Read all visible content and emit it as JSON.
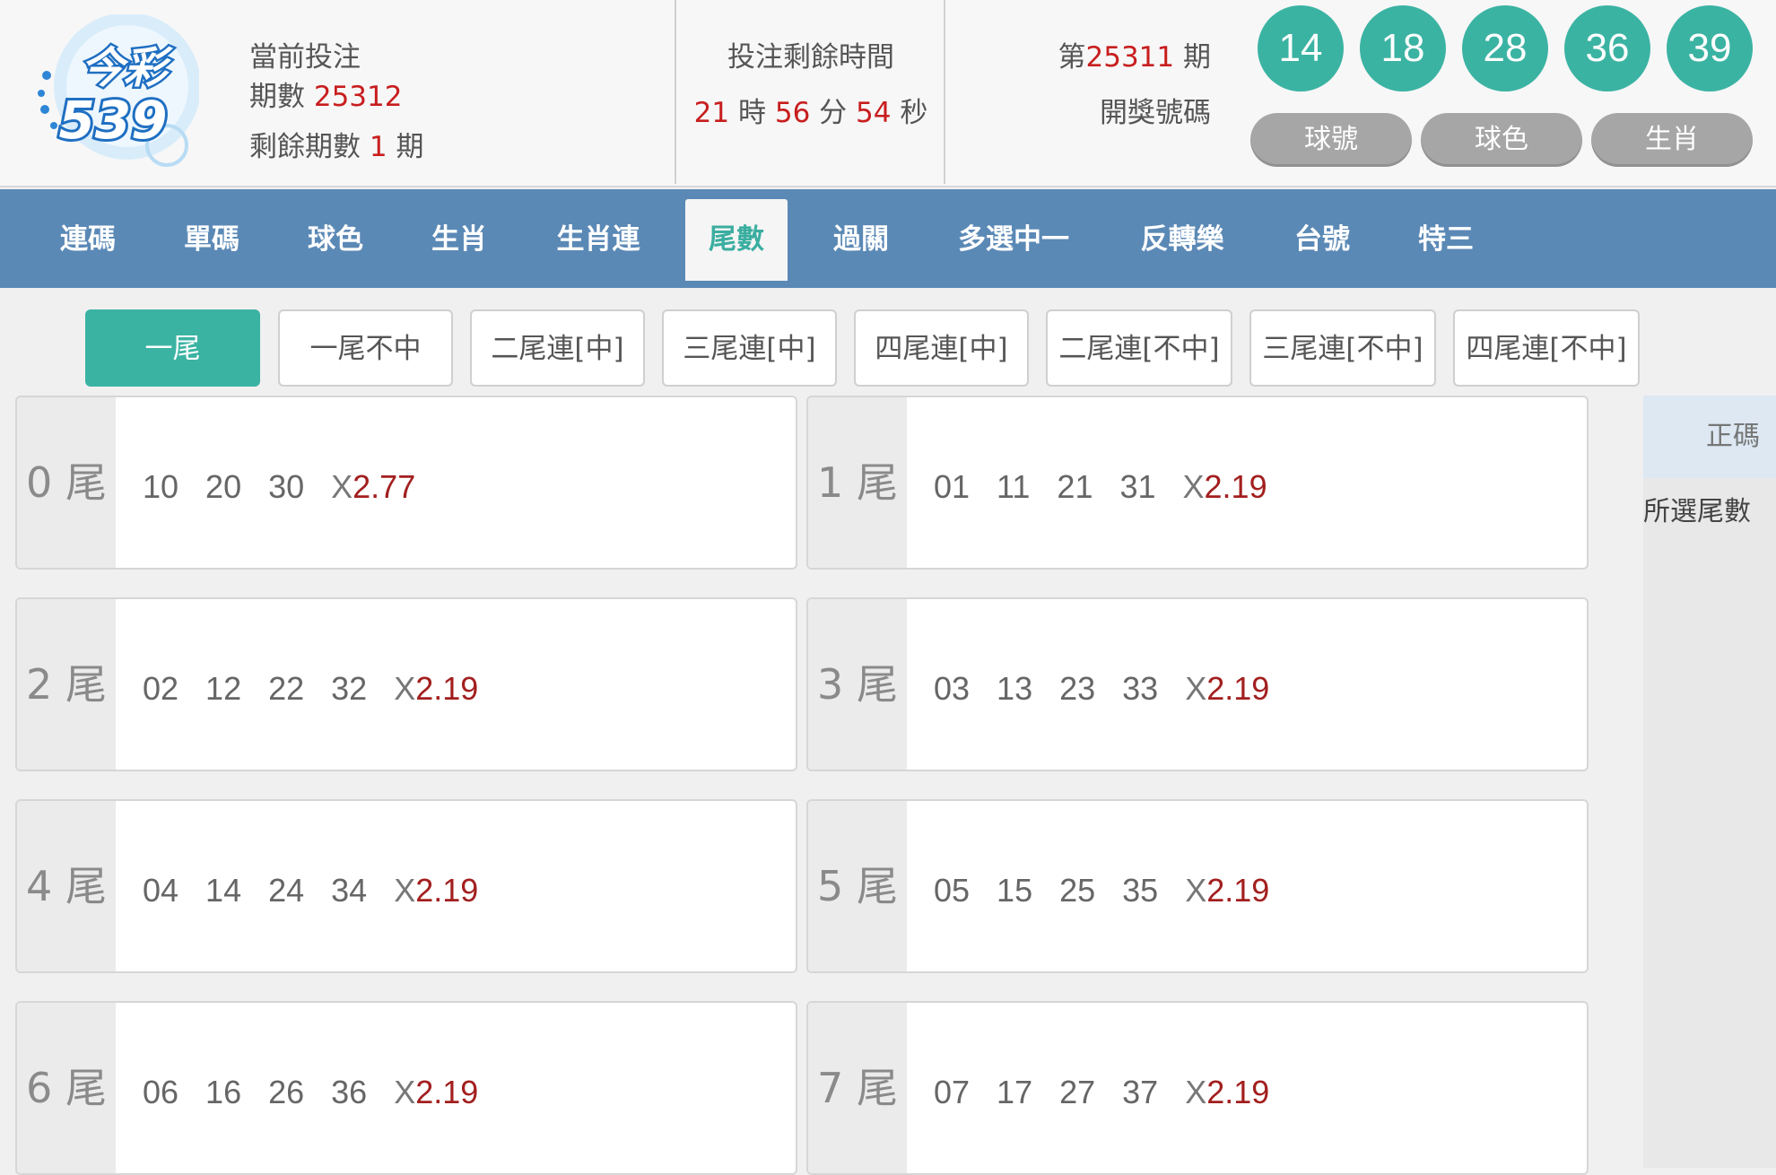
{
  "header": {
    "current_bet_label": "當前投注",
    "period_label": "期數",
    "period_value": "25312",
    "remaining_label": "剩餘期數",
    "remaining_value": "1",
    "remaining_unit": "期",
    "timer_title": "投注剩餘時間",
    "timer": {
      "hours": "21",
      "h_unit": "時",
      "minutes": "56",
      "m_unit": "分",
      "seconds": "54",
      "s_unit": "秒"
    },
    "last_draw_prefix": "第",
    "last_draw_period": "25311",
    "last_draw_suffix": "期",
    "last_draw_label": "開獎號碼",
    "balls": [
      "14",
      "18",
      "28",
      "36",
      "39"
    ],
    "pills": [
      "球號",
      "球色",
      "生肖"
    ],
    "colors": {
      "ball": "#3bb3a3",
      "pill": "#a6a6a6",
      "accent_red": "#c81e1e"
    }
  },
  "nav": {
    "items": [
      "連碼",
      "單碼",
      "球色",
      "生肖",
      "生肖連",
      "尾數",
      "過關",
      "多選中一",
      "反轉樂",
      "台號",
      "特三"
    ],
    "active": "尾數",
    "color": "#5b89b6"
  },
  "subtabs": {
    "items": [
      "一尾",
      "一尾不中",
      "二尾連[中]",
      "三尾連[中]",
      "四尾連[中]",
      "二尾連[不中]",
      "三尾連[不中]",
      "四尾連[不中]"
    ],
    "active": "一尾"
  },
  "cards": [
    {
      "digit": "0",
      "unit": "尾",
      "numbers": [
        "10",
        "20",
        "30"
      ],
      "x": "X",
      "odds": "2.77"
    },
    {
      "digit": "1",
      "unit": "尾",
      "numbers": [
        "01",
        "11",
        "21",
        "31"
      ],
      "x": "X",
      "odds": "2.19"
    },
    {
      "digit": "2",
      "unit": "尾",
      "numbers": [
        "02",
        "12",
        "22",
        "32"
      ],
      "x": "X",
      "odds": "2.19"
    },
    {
      "digit": "3",
      "unit": "尾",
      "numbers": [
        "03",
        "13",
        "23",
        "33"
      ],
      "x": "X",
      "odds": "2.19"
    },
    {
      "digit": "4",
      "unit": "尾",
      "numbers": [
        "04",
        "14",
        "24",
        "34"
      ],
      "x": "X",
      "odds": "2.19"
    },
    {
      "digit": "5",
      "unit": "尾",
      "numbers": [
        "05",
        "15",
        "25",
        "35"
      ],
      "x": "X",
      "odds": "2.19"
    },
    {
      "digit": "6",
      "unit": "尾",
      "numbers": [
        "06",
        "16",
        "26",
        "36"
      ],
      "x": "X",
      "odds": "2.19"
    },
    {
      "digit": "7",
      "unit": "尾",
      "numbers": [
        "07",
        "17",
        "27",
        "37"
      ],
      "x": "X",
      "odds": "2.19"
    }
  ],
  "side": {
    "tab": "正碼",
    "label": "所選尾數"
  },
  "logo": {
    "text1": "今彩",
    "text2": "539"
  }
}
